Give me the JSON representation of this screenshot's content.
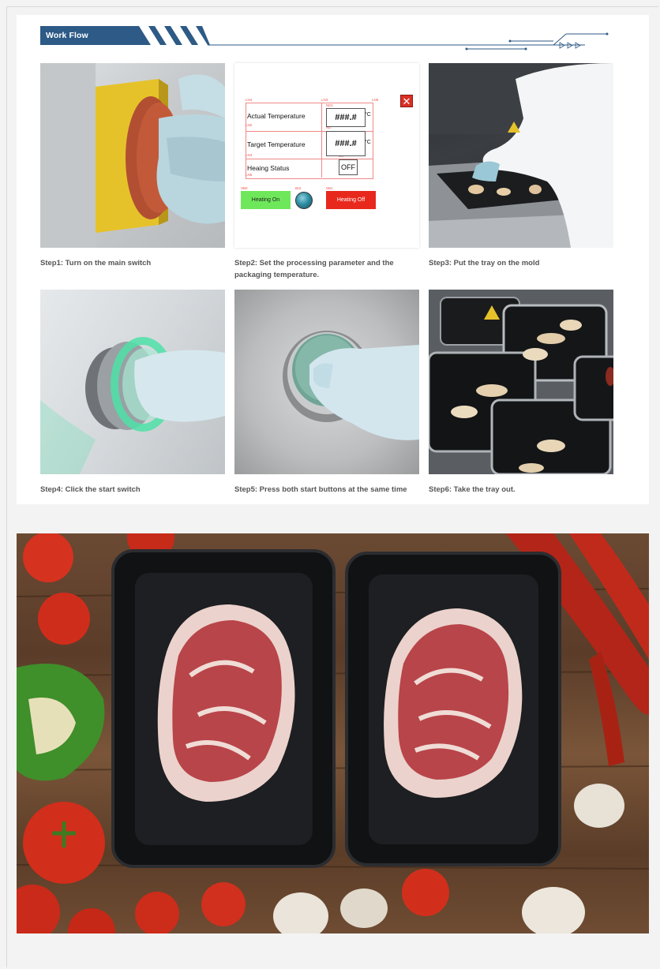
{
  "workflow": {
    "title": "Work Flow",
    "steps": [
      {
        "caption": "Step1: Turn on the main switch"
      },
      {
        "caption": "Step2: Set the processing parameter and the packaging temperature."
      },
      {
        "caption": "Step3: Put the tray on the mold"
      },
      {
        "caption": "Step4: Click the start switch"
      },
      {
        "caption": "Step5: Press both start buttons at the same time"
      },
      {
        "caption": "Step6: Take the tray out."
      }
    ]
  },
  "control_panel": {
    "actual_temp_label": "Actual Temperature",
    "target_temp_label": "Target Temperature",
    "status_label": "Heaing Status",
    "actual_temp_value": "###.#",
    "target_temp_value": "###.#",
    "unit": "°C",
    "status_value": "OFF",
    "heating_on_label": "Heating On",
    "heating_off_label": "Heating Off",
    "close_symbol": "✕",
    "tags": {
      "ln4": "LN4",
      "ln3": "LN3",
      "ln5": "LN5",
      "nd1": "ND1",
      "ln2": "LN2",
      "nd": "ND",
      "ln4b": "LN4",
      "bu": "BU",
      "ln6": "LN6",
      "sb0": "SB0",
      "bu1": "BUI",
      "sb1": "SB1"
    },
    "colors": {
      "on": "#6ee85a",
      "off": "#e8281c",
      "close": "#d93025"
    }
  },
  "colors": {
    "banner": "#2d5a86",
    "banner_line": "#2d5a86"
  }
}
